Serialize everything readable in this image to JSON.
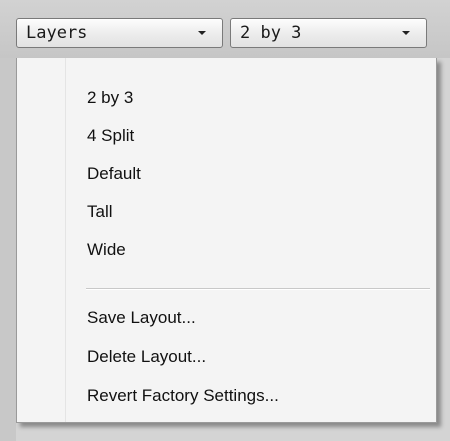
{
  "toolbar": {
    "layers_dropdown": {
      "value": "Layers"
    },
    "layout_dropdown": {
      "value": "2 by 3"
    }
  },
  "menu": {
    "layouts": [
      "2 by 3",
      "4 Split",
      "Default",
      "Tall",
      "Wide"
    ],
    "actions": [
      "Save Layout...",
      "Delete Layout...",
      "Revert Factory Settings..."
    ]
  },
  "icons": {
    "dropdown_arrow": "chevron-down-icon"
  },
  "colors": {
    "toolbar_bg": "#cccccc",
    "menu_bg": "#f4f4f4",
    "text": "#111111"
  }
}
